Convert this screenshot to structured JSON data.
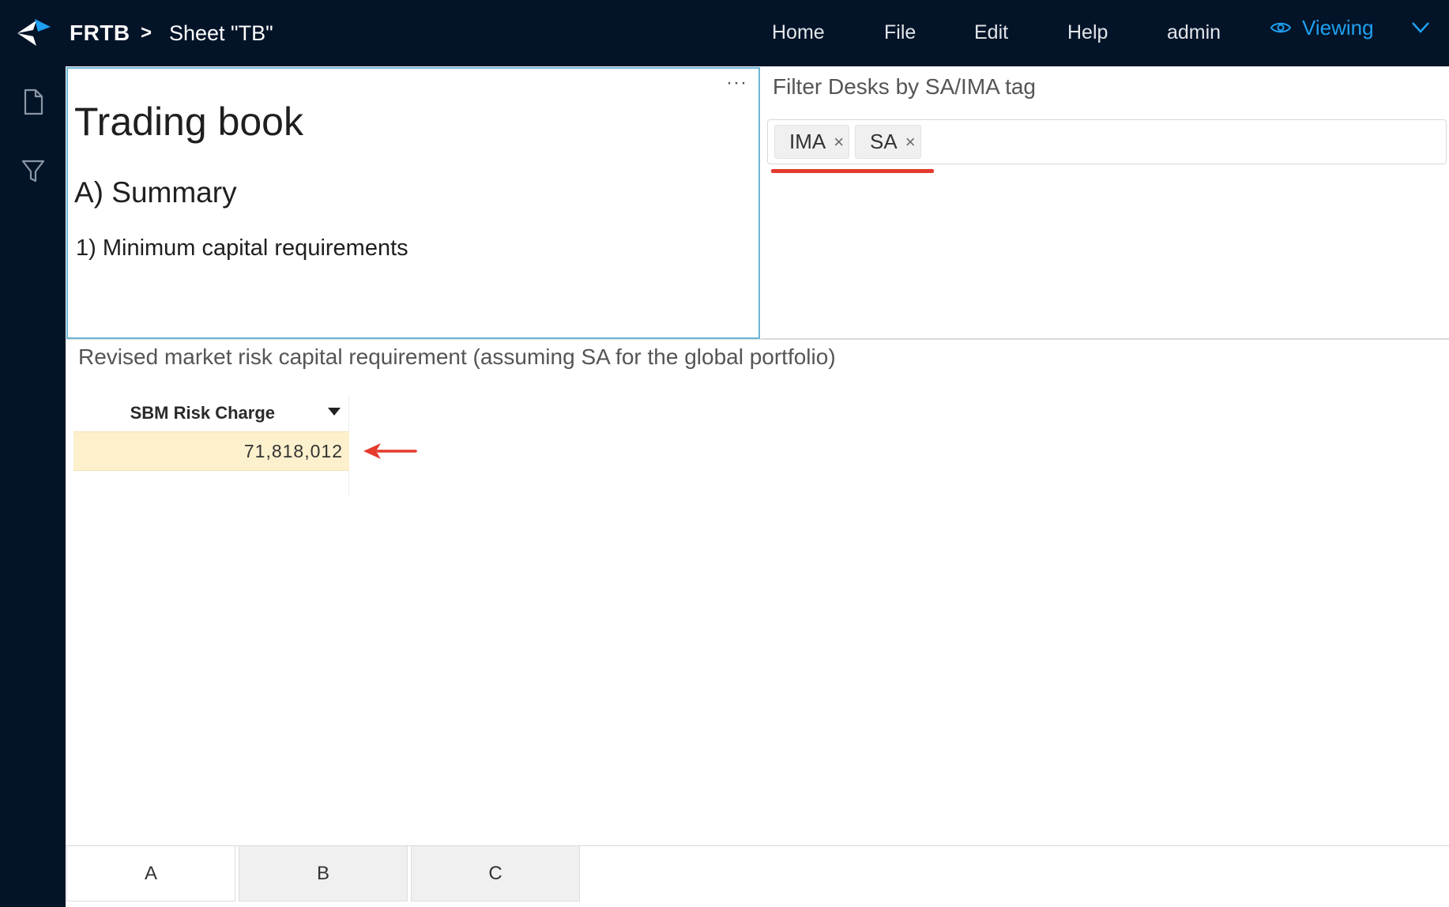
{
  "header": {
    "app_name": "FRTB",
    "breadcrumb_separator": ">",
    "sheet_name": "Sheet \"TB\"",
    "menu": [
      "Home",
      "File",
      "Edit",
      "Help",
      "admin"
    ],
    "mode_label": "Viewing"
  },
  "sidebar": {
    "icons": [
      "page-icon",
      "filter-icon"
    ]
  },
  "text_widget": {
    "menu_dots": "···",
    "heading1": "Trading book",
    "heading2": "A) Summary",
    "heading3": "1) Minimum capital requirements"
  },
  "filter_widget": {
    "title": "Filter Desks by SA/IMA tag",
    "tags": [
      "IMA",
      "SA"
    ],
    "tag_close": "×"
  },
  "pivot": {
    "title": "Revised market risk capital requirement (assuming SA for the global portfolio)",
    "column_header": "SBM Risk Charge",
    "value": "71,818,012"
  },
  "page_tabs": [
    "A",
    "B",
    "C"
  ],
  "colors": {
    "header_bg": "#041428",
    "accent": "#1ea0f0",
    "highlight_cell": "#fdf0cd",
    "annotation_red": "#e53a2e"
  }
}
